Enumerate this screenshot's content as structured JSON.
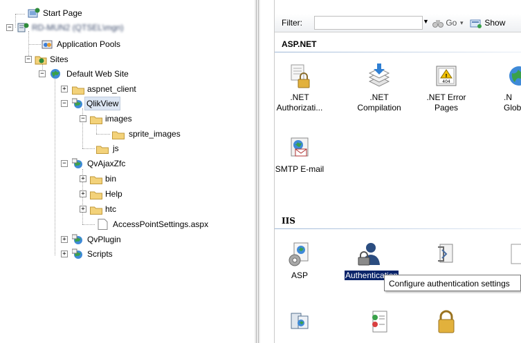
{
  "tree": {
    "nodes": [
      {
        "key": "start",
        "label": "Start Page",
        "icon": "start-page-icon"
      },
      {
        "key": "server",
        "label": "RD-MUN2 (QTSEL\\mgn)",
        "icon": "server-icon"
      },
      {
        "key": "apppools",
        "label": "Application Pools",
        "icon": "application-pools-icon"
      },
      {
        "key": "sites",
        "label": "Sites",
        "icon": "sites-folder-icon"
      },
      {
        "key": "dws",
        "label": "Default Web Site",
        "icon": "globe-icon"
      },
      {
        "key": "aspnet",
        "label": "aspnet_client",
        "icon": "folder-icon"
      },
      {
        "key": "qlikview",
        "label": "QlikView",
        "icon": "web-application-icon"
      },
      {
        "key": "images",
        "label": "images",
        "icon": "folder-icon"
      },
      {
        "key": "sprite",
        "label": "sprite_images",
        "icon": "folder-icon"
      },
      {
        "key": "js",
        "label": "js",
        "icon": "folder-icon"
      },
      {
        "key": "qvajax",
        "label": "QvAjaxZfc",
        "icon": "web-application-icon"
      },
      {
        "key": "bin",
        "label": "bin",
        "icon": "folder-icon"
      },
      {
        "key": "help",
        "label": "Help",
        "icon": "folder-icon"
      },
      {
        "key": "htc",
        "label": "htc",
        "icon": "folder-icon"
      },
      {
        "key": "aps",
        "label": "AccessPointSettings.aspx",
        "icon": "file-icon"
      },
      {
        "key": "qvplugin",
        "label": "QvPlugin",
        "icon": "web-application-icon"
      },
      {
        "key": "scripts",
        "label": "Scripts",
        "icon": "web-application-icon"
      }
    ],
    "selected": "QlikView"
  },
  "filterbar": {
    "filter_label": "Filter:",
    "filter_value": "",
    "go_label": "Go",
    "show_label": "Show"
  },
  "groups": {
    "aspnet": {
      "title": "ASP.NET",
      "features": [
        {
          "label": ".NET Authorizati...",
          "icon": "net-authorization-icon"
        },
        {
          "label": ".NET Compilation",
          "icon": "net-compilation-icon"
        },
        {
          "label": ".NET Error Pages",
          "icon": "net-error-pages-icon"
        },
        {
          "label": ".N Global",
          "icon": "net-globalization-icon"
        },
        {
          "label": "SMTP E-mail",
          "icon": "smtp-email-icon"
        }
      ]
    },
    "iis": {
      "title": "IIS",
      "features": [
        {
          "label": "ASP",
          "icon": "asp-icon"
        },
        {
          "label": "Authentication",
          "icon": "authentication-icon"
        },
        {
          "label": "",
          "icon": "compression-icon"
        },
        {
          "label": "",
          "icon": "partial-feature-icon"
        },
        {
          "label": "",
          "icon": "cgi-icon"
        },
        {
          "label": "",
          "icon": "default-document-icon"
        },
        {
          "label": "",
          "icon": "lock-icon"
        }
      ]
    }
  },
  "tooltip": {
    "text": "Configure authentication settings"
  },
  "colors": {
    "selection": "#dce6f4",
    "tooltip_border": "#767676",
    "folder": "#f3d27a",
    "globe": "#2e8b3a"
  }
}
